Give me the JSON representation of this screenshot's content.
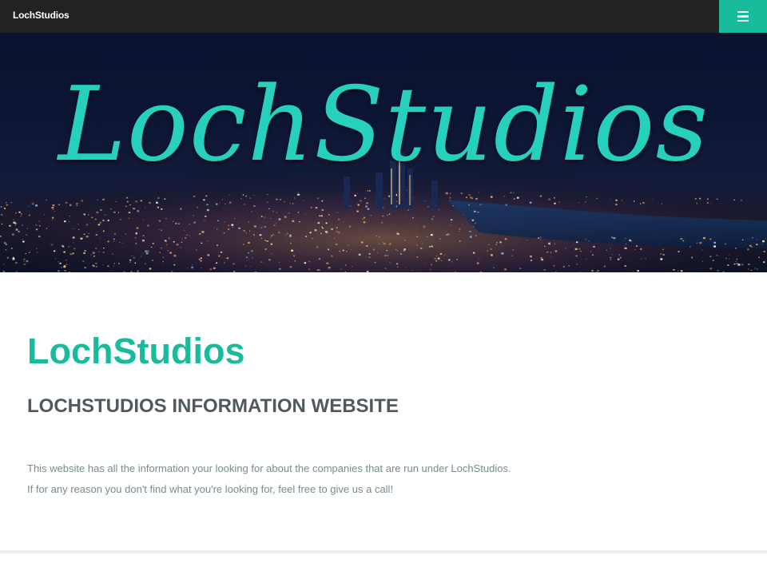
{
  "navbar": {
    "brand": "LochStudios",
    "menu_icon": "hamburger-icon",
    "bg_color": "#222222",
    "accent_color": "#18bc9c"
  },
  "hero": {
    "title": "LochStudios",
    "title_color": "#26d0bd",
    "background": "night city skyline"
  },
  "main": {
    "title": "LochStudios",
    "subtitle": "LOCHSTUDIOS INFORMATION WEBSITE",
    "paragraphs": [
      "This website has all the information your looking for about the companies that are run under LochStudios.",
      "If for any reason you don't find what you're looking for, feel free to give us a call!"
    ]
  }
}
